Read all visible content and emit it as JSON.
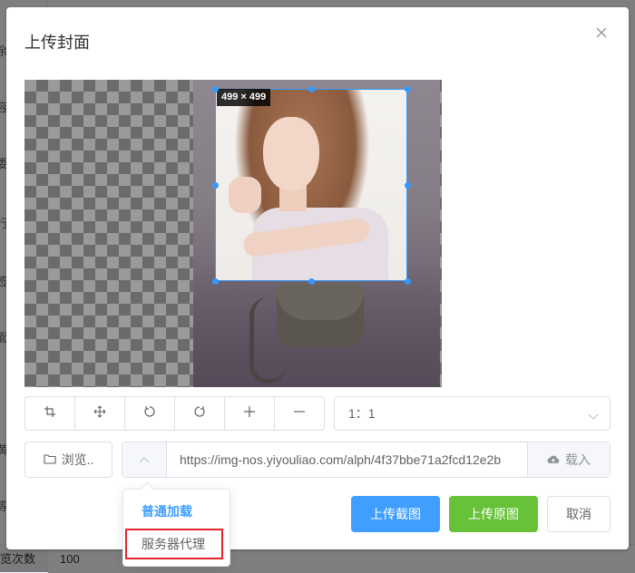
{
  "background": {
    "side_chars": [
      "余",
      "容",
      "委",
      "行",
      "签",
      "面",
      "黄",
      "等"
    ],
    "row_label": "览次数",
    "row_value": "100"
  },
  "dialog": {
    "title": "上传封面",
    "crop_size_label": "499 × 499",
    "ratio_value": "1：1",
    "browse_label": "浏览..",
    "url_value": "https://img-nos.yiyouliao.com/alph/4f37bbe71a2fcd12e2b",
    "load_label": "载入",
    "dropdown": {
      "items": [
        "普通加载",
        "服务器代理"
      ]
    },
    "buttons": {
      "upload_crop": "上传截图",
      "upload_original": "上传原图",
      "cancel": "取消"
    }
  },
  "icons": {
    "close": "close-icon",
    "crop": "crop-icon",
    "move": "move-icon",
    "rotate_left": "rotate-left-icon",
    "rotate_right": "rotate-right-icon",
    "zoom_in": "plus-icon",
    "zoom_out": "minus-icon",
    "folder": "folder-icon",
    "cloud": "cloud-upload-icon",
    "chevron_up": "chevron-up-icon",
    "chevron_down": "chevron-down-icon"
  },
  "colors": {
    "primary": "#409eff",
    "success": "#67c23a",
    "highlight_border": "#e0262b",
    "crop_border": "#3399ff"
  }
}
